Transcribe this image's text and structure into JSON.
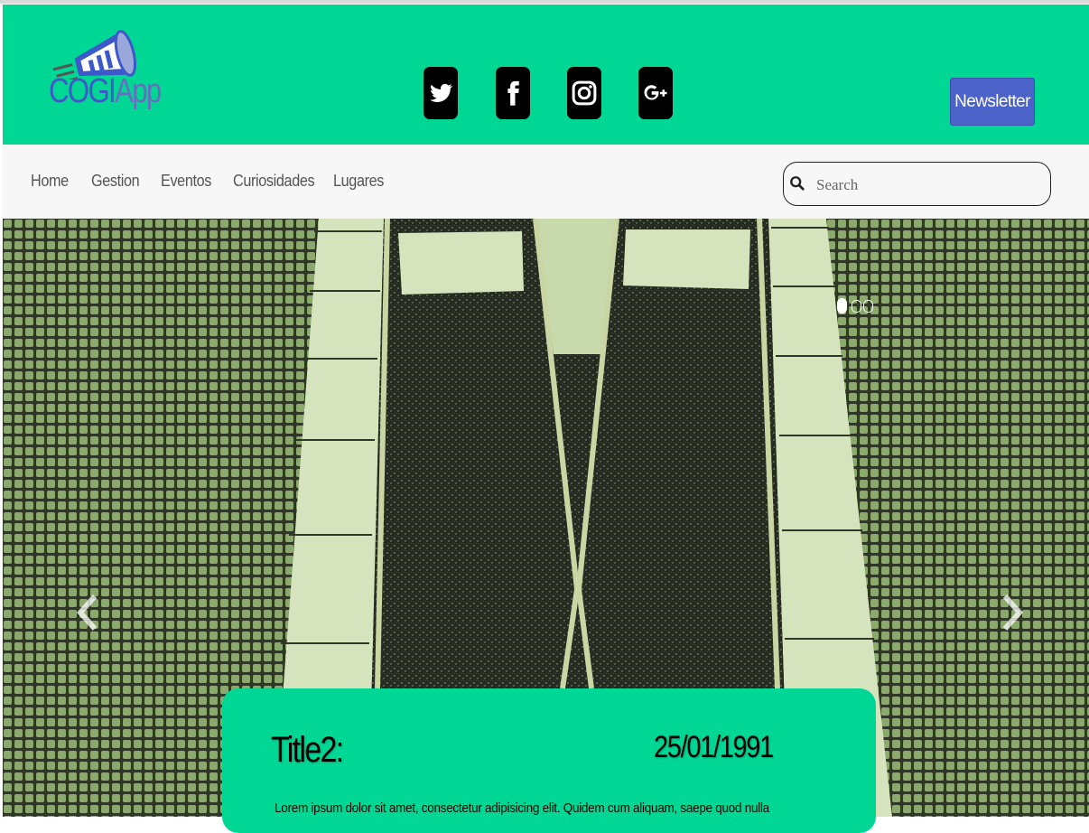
{
  "brand": {
    "logo_text_1": "COGI",
    "logo_text_2": "App"
  },
  "social": [
    {
      "icon": "twitter-icon"
    },
    {
      "icon": "facebook-icon"
    },
    {
      "icon": "instagram-icon"
    },
    {
      "icon": "google-plus-icon"
    }
  ],
  "header": {
    "newsletter_label": "Newsletter",
    "bg_color": "#00d795",
    "newsletter_color": "#4b63c9"
  },
  "nav": {
    "items": [
      "Home",
      "Gestion",
      "Eventos",
      "Curiosidades",
      "Lugares"
    ]
  },
  "search": {
    "placeholder": "Search",
    "value": ""
  },
  "carousel": {
    "active_slide": 1,
    "slide_count": 3,
    "caption": {
      "title": "Title2:",
      "date": "25/01/1991",
      "text": "Lorem ipsum dolor sit amet, consectetur adipisicing elit. Quidem cum aliquam, saepe quod nulla"
    }
  }
}
